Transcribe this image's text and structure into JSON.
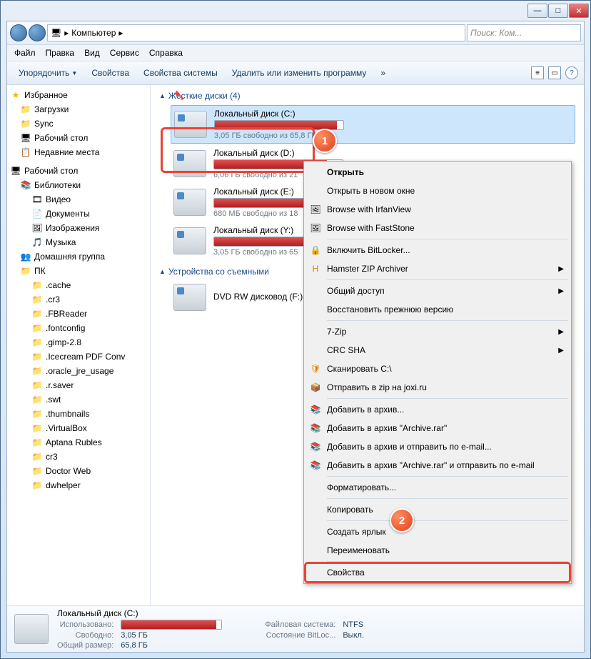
{
  "titlebar": {
    "min": "—",
    "max": "□",
    "close": "✕"
  },
  "addr": {
    "computer": "Компьютер",
    "arrow": "▸",
    "search_ph": "Поиск: Ком..."
  },
  "menu": {
    "file": "Файл",
    "edit": "Правка",
    "view": "Вид",
    "service": "Сервис",
    "help": "Справка"
  },
  "toolbar": {
    "organize": "Упорядочить",
    "props": "Свойства",
    "sysprops": "Свойства системы",
    "uninstall": "Удалить или изменить программу",
    "more": "»"
  },
  "tree": {
    "fav": "Избранное",
    "downloads": "Загрузки",
    "sync": "Sync",
    "desktop": "Рабочий стол",
    "recent": "Недавние места",
    "desktop2": "Рабочий стол",
    "libs": "Библиотеки",
    "video": "Видео",
    "docs": "Документы",
    "images": "Изображения",
    "music": "Музыка",
    "homegroup": "Домашняя группа",
    "pc": "ПК",
    "f": [
      ".cache",
      ".cr3",
      ".FBReader",
      ".fontconfig",
      ".gimp-2.8",
      ".Icecream PDF Conv",
      ".oracle_jre_usage",
      ".r.saver",
      ".swt",
      ".thumbnails",
      ".VirtualBox",
      "Aptana Rubles",
      "cr3",
      "Doctor Web",
      "dwhelper"
    ]
  },
  "groups": {
    "hard": "Жесткие диски (4)",
    "removable": "Устройства со съемными"
  },
  "drives": [
    {
      "name": "Локальный диск (C:)",
      "free": "3,05 ГБ свободно из 65,8 ГБ",
      "fill": 95
    },
    {
      "name": "Локальный диск (D:)",
      "free": "6,06 ГБ свободно из 21",
      "fill": 88
    },
    {
      "name": "Локальный диск (E:)",
      "free": "680 МБ свободно из 18",
      "fill": 96
    },
    {
      "name": "Локальный диск (Y:)",
      "free": "3,05 ГБ свободно из 65",
      "fill": 95
    }
  ],
  "dvd": "DVD RW дисковод (F:)",
  "ctx": {
    "open": "Открыть",
    "opennew": "Открыть в новом окне",
    "irfan": "Browse with IrfanView",
    "fast": "Browse with FastStone",
    "bitlocker": "Включить BitLocker...",
    "hamster": "Hamster ZIP Archiver",
    "share": "Общий доступ",
    "restore": "Восстановить прежнюю версию",
    "7zip": "7-Zip",
    "crc": "CRC SHA",
    "scan": "Сканировать C:\\",
    "joxi": "Отправить в zip на joxi.ru",
    "add": "Добавить в архив...",
    "addrar": "Добавить в архив \"Archive.rar\"",
    "addemail": "Добавить в архив и отправить по e-mail...",
    "addraremail": "Добавить в архив \"Archive.rar\" и отправить по e-mail",
    "format": "Форматировать...",
    "copy": "Копировать",
    "shortcut": "Создать ярлык",
    "rename": "Переименовать",
    "props": "Свойства"
  },
  "status": {
    "name": "Локальный диск (C:)",
    "used_l": "Использовано:",
    "free_l": "Свободно:",
    "free_v": "3,05 ГБ",
    "total_l": "Общий размер:",
    "total_v": "65,8 ГБ",
    "fs_l": "Файловая система:",
    "fs_v": "NTFS",
    "bl_l": "Состояние BitLoc...",
    "bl_v": "Выкл."
  },
  "badges": {
    "b1": "1",
    "b2": "2"
  }
}
